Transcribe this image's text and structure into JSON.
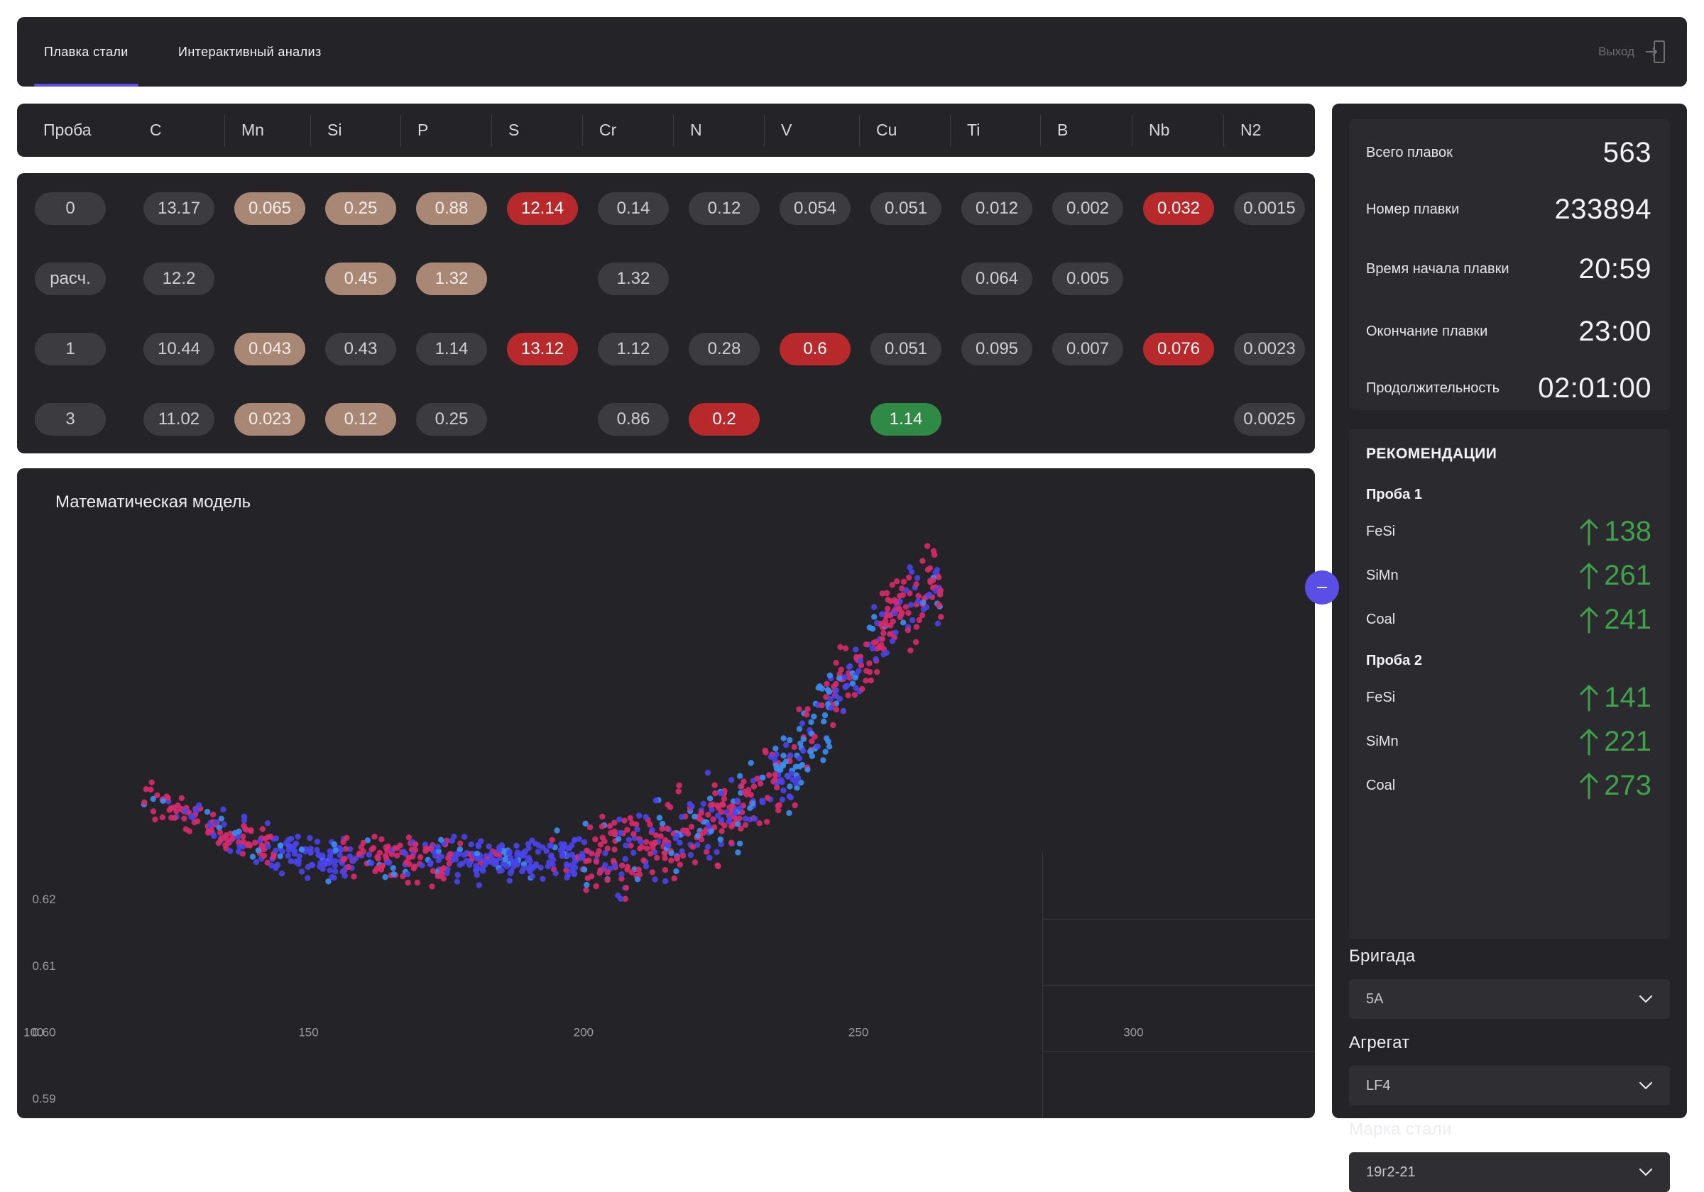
{
  "nav": {
    "tabs": [
      {
        "label": "Плавка стали",
        "active": true
      },
      {
        "label": "Интерактивный анализ",
        "active": false
      }
    ],
    "logout_label": "Выход"
  },
  "table": {
    "columns": [
      "Проба",
      "C",
      "Mn",
      "Si",
      "P",
      "S",
      "Cr",
      "N",
      "V",
      "Cu",
      "Ti",
      "B",
      "Nb",
      "N2"
    ],
    "rows": [
      {
        "label": "0",
        "cells": [
          {
            "value": "13.17",
            "status": "neutral"
          },
          {
            "value": "0.065",
            "status": "warn"
          },
          {
            "value": "0.25",
            "status": "warn"
          },
          {
            "value": "0.88",
            "status": "warn"
          },
          {
            "value": "12.14",
            "status": "bad"
          },
          {
            "value": "0.14",
            "status": "neutral"
          },
          {
            "value": "0.12",
            "status": "neutral"
          },
          {
            "value": "0.054",
            "status": "neutral"
          },
          {
            "value": "0.051",
            "status": "neutral"
          },
          {
            "value": "0.012",
            "status": "neutral"
          },
          {
            "value": "0.002",
            "status": "neutral"
          },
          {
            "value": "0.032",
            "status": "bad"
          },
          {
            "value": "0.0015",
            "status": "neutral"
          }
        ]
      },
      {
        "label": "расч.",
        "cells": [
          {
            "value": "12.2",
            "status": "neutral"
          },
          null,
          {
            "value": "0.45",
            "status": "warn"
          },
          {
            "value": "1.32",
            "status": "warn"
          },
          null,
          {
            "value": "1.32",
            "status": "neutral"
          },
          null,
          null,
          null,
          {
            "value": "0.064",
            "status": "neutral"
          },
          {
            "value": "0.005",
            "status": "neutral"
          },
          null,
          null
        ]
      },
      {
        "label": "1",
        "cells": [
          {
            "value": "10.44",
            "status": "neutral"
          },
          {
            "value": "0.043",
            "status": "warn"
          },
          {
            "value": "0.43",
            "status": "neutral"
          },
          {
            "value": "1.14",
            "status": "neutral"
          },
          {
            "value": "13.12",
            "status": "bad"
          },
          {
            "value": "1.12",
            "status": "neutral"
          },
          {
            "value": "0.28",
            "status": "neutral"
          },
          {
            "value": "0.6",
            "status": "bad"
          },
          {
            "value": "0.051",
            "status": "neutral"
          },
          {
            "value": "0.095",
            "status": "neutral"
          },
          {
            "value": "0.007",
            "status": "neutral"
          },
          {
            "value": "0.076",
            "status": "bad"
          },
          {
            "value": "0.0023",
            "status": "neutral"
          }
        ]
      },
      {
        "label": "3",
        "cells": [
          {
            "value": "11.02",
            "status": "neutral"
          },
          {
            "value": "0.023",
            "status": "warn"
          },
          {
            "value": "0.12",
            "status": "warn"
          },
          {
            "value": "0.25",
            "status": "neutral"
          },
          null,
          {
            "value": "0.86",
            "status": "neutral"
          },
          {
            "value": "0.2",
            "status": "bad"
          },
          null,
          {
            "value": "1.14",
            "status": "good"
          },
          null,
          null,
          null,
          {
            "value": "0.0025",
            "status": "neutral"
          }
        ]
      }
    ]
  },
  "chart": {
    "title": "Математическая модель"
  },
  "chart_data": {
    "type": "scatter",
    "title": "Математическая модель",
    "xlabel": "",
    "ylabel": "",
    "x_ticks": [
      "100",
      "150",
      "200",
      "250",
      "300"
    ],
    "y_ticks": [
      "0.62",
      "0.61",
      "0.60",
      "0.59"
    ],
    "xlim": [
      97,
      333
    ],
    "ylim": [
      0.587,
      0.671
    ],
    "grid": false,
    "series": [
      {
        "color": "#d72a6a"
      },
      {
        "color": "#4a43e8"
      },
      {
        "color": "#3b8cf0"
      }
    ],
    "cluster_shape": [
      {
        "x": 120,
        "y": 0.636
      },
      {
        "x": 135,
        "y": 0.63
      },
      {
        "x": 150,
        "y": 0.626
      },
      {
        "x": 170,
        "y": 0.626
      },
      {
        "x": 190,
        "y": 0.626
      },
      {
        "x": 210,
        "y": 0.627
      },
      {
        "x": 225,
        "y": 0.632
      },
      {
        "x": 238,
        "y": 0.64
      },
      {
        "x": 245,
        "y": 0.65
      },
      {
        "x": 252,
        "y": 0.658
      },
      {
        "x": 258,
        "y": 0.664
      },
      {
        "x": 263,
        "y": 0.667
      }
    ]
  },
  "stats": [
    {
      "label": "Всего плавок",
      "value": "563"
    },
    {
      "label": "Номер плавки",
      "value": "233894"
    },
    {
      "label": "Время начала плавки",
      "value": "20:59"
    },
    {
      "label": "Окончание плавки",
      "value": "23:00"
    },
    {
      "label": "Продолжительность",
      "value": "02:01:00"
    }
  ],
  "recommendations": {
    "title": "РЕКОМЕНДАЦИИ",
    "groups": [
      {
        "name": "Проба 1",
        "items": [
          {
            "name": "FeSi",
            "value": "138",
            "trend": "up"
          },
          {
            "name": "SiMn",
            "value": "261",
            "trend": "up"
          },
          {
            "name": "Coal",
            "value": "241",
            "trend": "up"
          }
        ]
      },
      {
        "name": "Проба 2",
        "items": [
          {
            "name": "FeSi",
            "value": "141",
            "trend": "up"
          },
          {
            "name": "SiMn",
            "value": "221",
            "trend": "up"
          },
          {
            "name": "Coal",
            "value": "273",
            "trend": "up"
          }
        ]
      }
    ]
  },
  "filters": [
    {
      "label": "Бригада",
      "value": "5А"
    },
    {
      "label": "Агрегат",
      "value": "LF4"
    },
    {
      "label": "Марка стали",
      "value": "19г2-21"
    }
  ],
  "colors": {
    "accent": "#5a4ee6",
    "panel": "#242428",
    "status_warn": "#a98775",
    "status_bad": "#b8292b",
    "status_good": "#2f8a45",
    "trend_up": "#3fa24a"
  }
}
